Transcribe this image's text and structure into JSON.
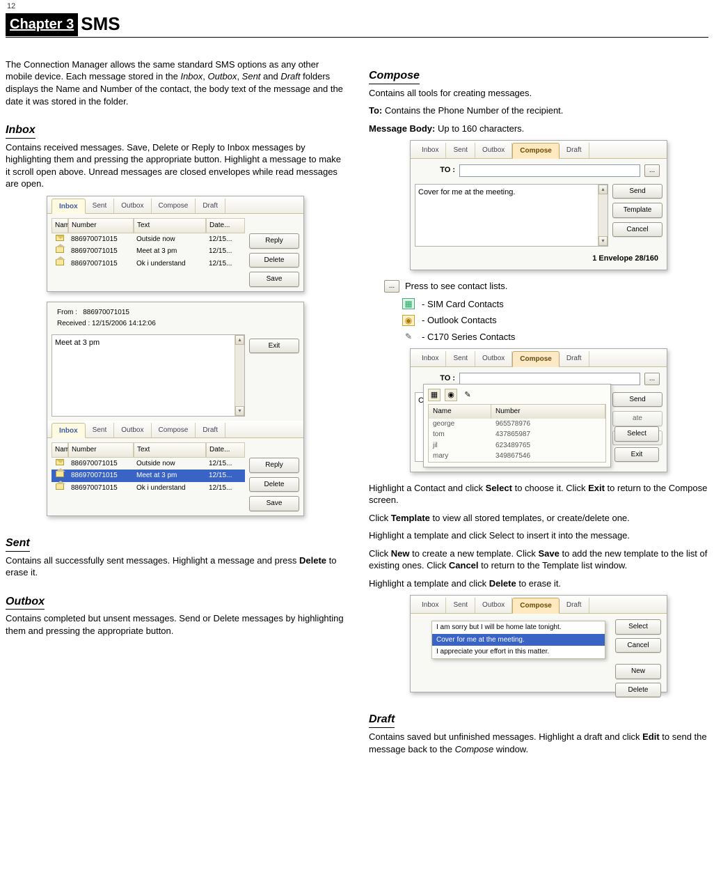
{
  "page_number": "12",
  "chapter_label": "Chapter 3",
  "chapter_title": "SMS",
  "intro_text": "The Connection Manager allows the same standard SMS options as any other mobile device. Each message stored in the Inbox, Outbox, Sent and Draft folders displays the Name and Number of the contact, the body text of the message and the date it was stored in the folder.",
  "intro_italics": {
    "a": "Inbox",
    "b": "Outbox",
    "c": "Sent",
    "d": "Draft"
  },
  "tabs": {
    "inbox": "Inbox",
    "sent": "Sent",
    "outbox": "Outbox",
    "compose": "Compose",
    "draft": "Draft"
  },
  "grid_headers": {
    "name": "Name",
    "number": "Number",
    "text": "Text",
    "date": "Date..."
  },
  "inbox": {
    "heading": "Inbox",
    "text": "Contains received messages. Save, Delete or Reply to Inbox messages by highlighting them and pressing the appropriate button. Highlight a message to make it scroll open above. Unread messages are closed envelopes while read messages are open.",
    "rows": [
      {
        "number": "886970071015",
        "text": "Outside now",
        "date": "12/15..."
      },
      {
        "number": "886970071015",
        "text": "Meet at 3 pm",
        "date": "12/15..."
      },
      {
        "number": "886970071015",
        "text": "Ok i understand",
        "date": "12/15..."
      }
    ],
    "buttons": {
      "reply": "Reply",
      "delete": "Delete",
      "save": "Save"
    },
    "preview": {
      "from_label": "From :",
      "from_value": "886970071015",
      "received_label": "Received :",
      "received_value": "12/15/2006 14:12:06",
      "body": "Meet at 3 pm",
      "exit": "Exit"
    }
  },
  "sent": {
    "heading": "Sent",
    "text_a": "Contains all successfully sent messages. Highlight a message and press ",
    "delete_word": "Delete",
    "text_b": " to erase it."
  },
  "outbox": {
    "heading": "Outbox",
    "text": "Contains completed but unsent messages. Send or Delete messages by highlighting them and pressing the appropriate button."
  },
  "compose": {
    "heading": "Compose",
    "line1": "Contains all tools for creating messages.",
    "to_label_bold": "To:",
    "to_desc": " Contains the Phone Number of the recipient.",
    "body_label_bold": "Message Body:",
    "body_desc": " Up to 160 characters.",
    "to_field_label": "TO :",
    "message_body": "Cover for me at the meeting.",
    "char_count": "1 Envelope  28/160",
    "buttons": {
      "send": "Send",
      "template": "Template",
      "cancel": "Cancel"
    },
    "dots_label": "...",
    "dots_desc": "Press to see contact lists.",
    "contact_types": {
      "sim": "- SIM Card Contacts",
      "outlook": "- Outlook Contacts",
      "c170": "- C170 Series Contacts"
    },
    "popup": {
      "headers": {
        "name": "Name",
        "number": "Number"
      },
      "rows": [
        {
          "name": "george",
          "number": "965578976"
        },
        {
          "name": "tom",
          "number": "437865987"
        },
        {
          "name": "jil",
          "number": "623489765"
        },
        {
          "name": "mary",
          "number": "349867546"
        }
      ],
      "select": "Select",
      "exit": "Exit"
    },
    "after_popup": {
      "p1a": "Highlight a Contact and click ",
      "p1b": "Select",
      "p1c": " to choose it. Click ",
      "p1d": "Exit",
      "p1e": " to return to the Compose screen.",
      "p2a": "Click ",
      "p2b": "Template",
      "p2c": " to view all stored templates, or create/delete one.",
      "p3": "Highlight a template and click Select to insert it into the message.",
      "p4a": "Click ",
      "p4b": "New",
      "p4c": " to create a new template. Click ",
      "p4d": "Save",
      "p4e": " to add the new template to the list of existing ones. Click ",
      "p4f": "Cancel",
      "p4g": " to return to the Template list window.",
      "p5a": "Highlight a template and click ",
      "p5b": "Delete",
      "p5c": " to erase it."
    },
    "template_ss": {
      "items": [
        "I am sorry but I will be home late tonight.",
        "Cover for me at the meeting.",
        "I appreciate your effort in this matter."
      ],
      "select": "Select",
      "cancel": "Cancel",
      "new": "New",
      "delete": "Delete"
    }
  },
  "draft": {
    "heading": "Draft",
    "text_a": "Contains saved but unfinished messages. Highlight a draft and click ",
    "edit_word": "Edit",
    "text_b": " to send the message back to the ",
    "compose_word": "Compose",
    "text_c": " window."
  }
}
